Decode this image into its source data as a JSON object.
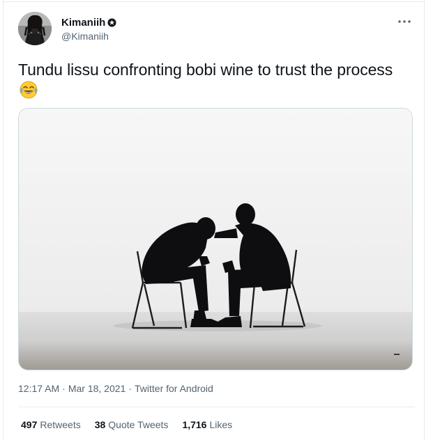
{
  "author": {
    "display_name": "Kimaniih",
    "handle": "@Kimaniih",
    "avatar_icon": "avatar-photo",
    "badge_icon": "star-badge-icon"
  },
  "more_icon": "more-options-icon",
  "tweet": {
    "text": "Tundu lissu confronting bobi wine to  trust the process",
    "emoji": "face-with-tears-of-joy"
  },
  "media": {
    "description_icon": "photo-two-men-on-chairs"
  },
  "meta": {
    "time": "12:17 AM",
    "separator1": "·",
    "date": "Mar 18, 2021",
    "separator2": "·",
    "source": "Twitter for Android"
  },
  "stats": [
    {
      "count": "497",
      "label": "Retweets"
    },
    {
      "count": "38",
      "label": "Quote Tweets"
    },
    {
      "count": "1,716",
      "label": "Likes"
    }
  ],
  "colors": {
    "text_primary": "#0f1419",
    "text_secondary": "#536471",
    "border": "#e6ecf0"
  }
}
